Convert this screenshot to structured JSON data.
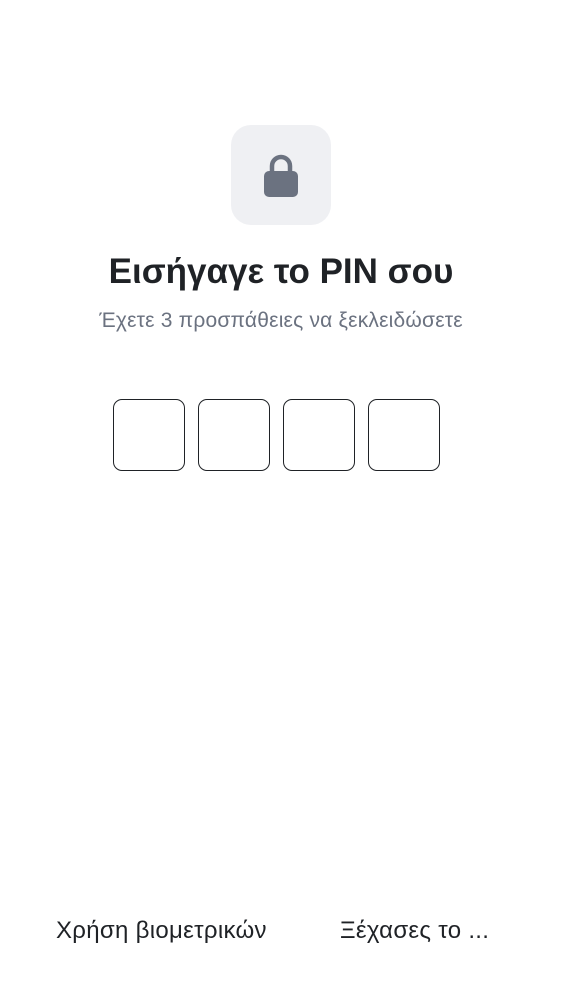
{
  "lock": {
    "icon": "lock-icon"
  },
  "title": "Εισήγαγε το PIN σου",
  "subtitle": "Έχετε 3 προσπάθειες να ξεκλειδώσετε",
  "pin": {
    "length": 4,
    "entered": 0
  },
  "actions": {
    "biometric_label": "Χρήση βιομετρικών",
    "forgot_label": "Ξέχασες το ..."
  },
  "colors": {
    "background": "#ffffff",
    "tile_bg": "#eff0f3",
    "icon": "#6b7280",
    "text_primary": "#1f2226",
    "text_secondary": "#6b7280"
  }
}
